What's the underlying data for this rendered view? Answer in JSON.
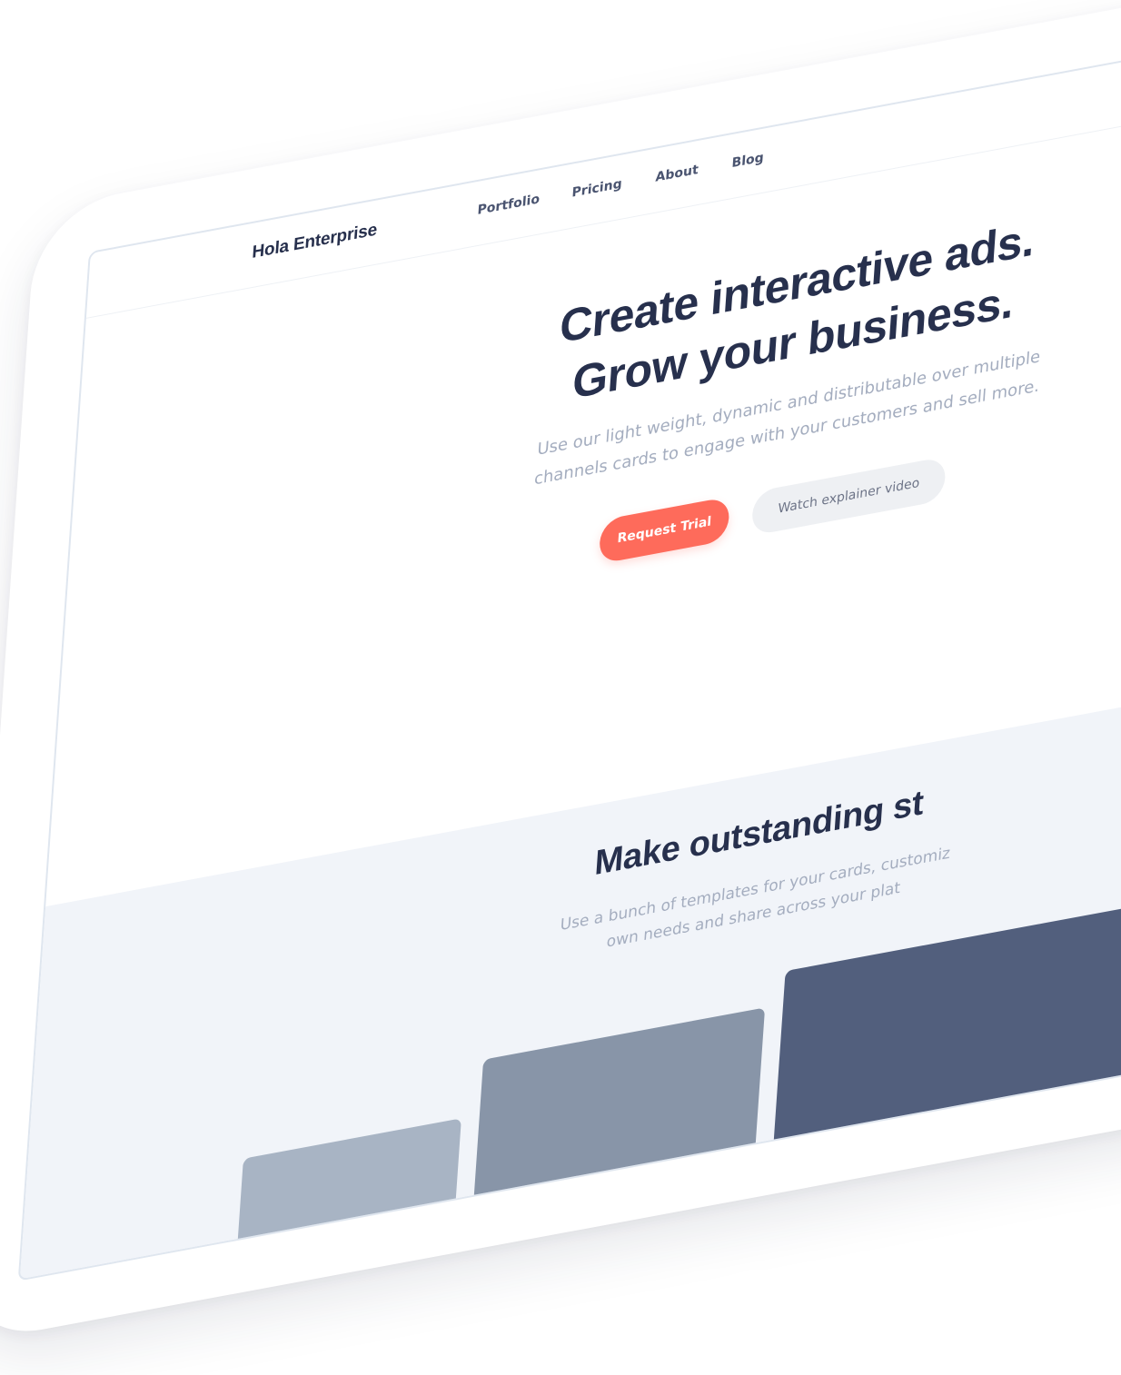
{
  "nav": {
    "brand": "Hola Enterprise",
    "links": [
      "Portfolio",
      "Pricing",
      "About",
      "Blog"
    ]
  },
  "hero": {
    "title_line1": "Create interactive ads.",
    "title_line2": "Grow your business.",
    "subtitle_line1": "Use our light weight, dynamic and distributable over multiple",
    "subtitle_line2": "channels cards to engage with your customers and sell more.",
    "primary_button": "Request Trial",
    "secondary_button": "Watch explainer video"
  },
  "features": {
    "title": "Make outstanding st",
    "subtitle_line1": "Use a bunch of templates for your cards, customiz",
    "subtitle_line2": "own needs and share across your plat"
  },
  "colors": {
    "accent": "#fe6b5b",
    "heading": "#27304d",
    "muted_text": "#a4adbf",
    "section_bg": "#f1f4f9",
    "card_light": "#a8b4c4",
    "card_medium": "#8895a8",
    "card_dark": "#525f7d"
  }
}
